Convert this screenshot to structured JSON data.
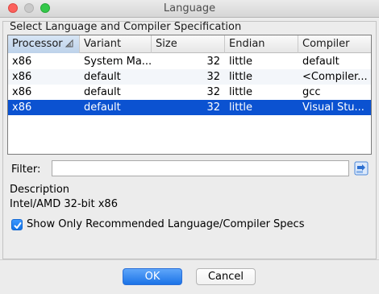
{
  "window": {
    "title": "Language"
  },
  "group": {
    "title": "Select Language and Compiler Specification"
  },
  "table": {
    "columns": [
      "Processor",
      "Variant",
      "Size",
      "Endian",
      "Compiler"
    ],
    "sorted_column": "Processor",
    "rows": [
      {
        "processor": "x86",
        "variant": "System Ma...",
        "size": "32",
        "endian": "little",
        "compiler": "default",
        "selected": false
      },
      {
        "processor": "x86",
        "variant": "default",
        "size": "32",
        "endian": "little",
        "compiler": "<Compiler...",
        "selected": false
      },
      {
        "processor": "x86",
        "variant": "default",
        "size": "32",
        "endian": "little",
        "compiler": "gcc",
        "selected": false
      },
      {
        "processor": "x86",
        "variant": "default",
        "size": "32",
        "endian": "little",
        "compiler": "Visual Stu...",
        "selected": true
      }
    ]
  },
  "filter": {
    "label": "Filter:",
    "value": "",
    "placeholder": "",
    "icon": "clear-filter-icon"
  },
  "description": {
    "label": "Description",
    "value": "Intel/AMD 32-bit x86"
  },
  "recommended": {
    "label": "Show Only Recommended Language/Compiler Specs",
    "checked": true
  },
  "buttons": {
    "ok": "OK",
    "cancel": "Cancel"
  },
  "colors": {
    "selection": "#0b52d1",
    "accent": "#1b73e7"
  }
}
